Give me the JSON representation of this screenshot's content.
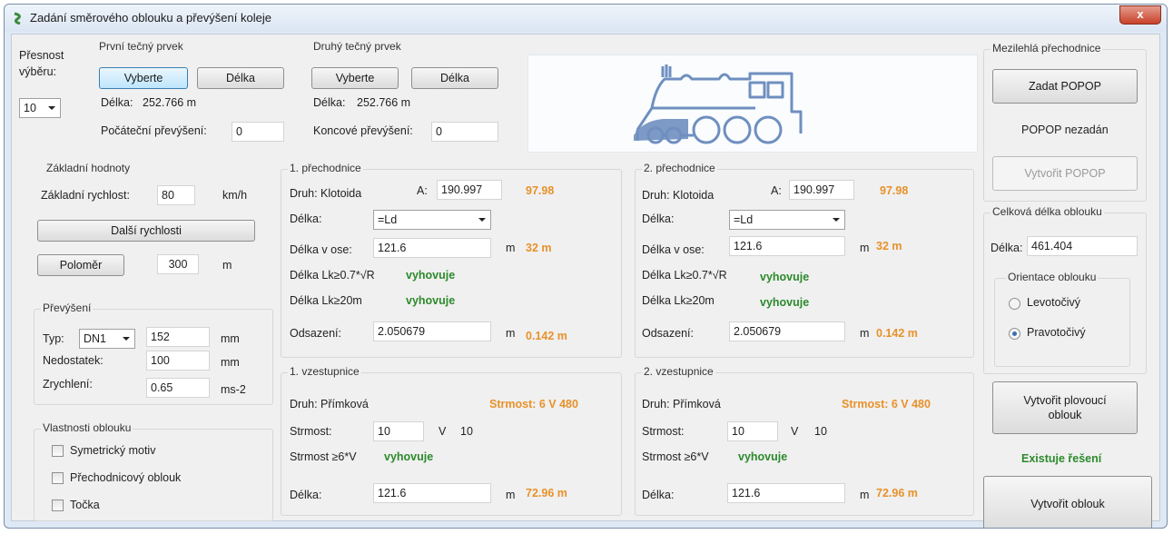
{
  "window": {
    "title": "Zadání směrového oblouku a převýšení koleje",
    "close": "x"
  },
  "precision": {
    "label1": "Přesnost",
    "label2": "výběru:",
    "value": "10"
  },
  "first": {
    "title": "První tečný prvek",
    "select_btn": "Vyberte",
    "length_btn": "Délka",
    "length_label": "Délka:",
    "length_value": "252.766 m",
    "cant_label": "Počáteční převýšení:",
    "cant_value": "0"
  },
  "second": {
    "title": "Druhý tečný prvek",
    "select_btn": "Vyberte",
    "length_btn": "Délka",
    "length_label": "Délka:",
    "length_value": "252.766 m",
    "cant_label": "Koncové převýšení:",
    "cant_value": "0"
  },
  "basic": {
    "title": "Základní hodnoty",
    "speed_label": "Základní rychlost:",
    "speed_value": "80",
    "speed_unit": "km/h",
    "more_speeds": "Další rychlosti",
    "radius_btn": "Poloměr",
    "radius_value": "300",
    "radius_unit": "m"
  },
  "cant": {
    "title": "Převýšení",
    "type_label": "Typ:",
    "type_value": "DN1",
    "type_num": "152",
    "type_unit": "mm",
    "deficit_label": "Nedostatek:",
    "deficit_value": "100",
    "deficit_unit": "mm",
    "accel_label": "Zrychlení:",
    "accel_value": "0.65",
    "accel_unit": "ms-2"
  },
  "props": {
    "title": "Vlastnosti oblouku",
    "items": [
      "Symetrický motiv",
      "Přechodnicový oblouk",
      "Točka"
    ]
  },
  "trans1": {
    "title": "1. přechodnice",
    "kind": "Druh: Klotoida",
    "a_label": "A:",
    "a_value": "190.997",
    "a_result": "97.98",
    "len_label": "Délka:",
    "len_select": "=Ld",
    "axis_label": "Délka v ose:",
    "axis_value": "121.6",
    "axis_unit": "m",
    "axis_result": "32 m",
    "check1_label": "Délka Lk≥0.7*√R",
    "check1_result": "vyhovuje",
    "check2_label": "Délka Lk≥20m",
    "check2_result": "vyhovuje",
    "offset_label": "Odsazení:",
    "offset_value": "2.050679",
    "offset_unit": "m",
    "offset_result": "0.142 m"
  },
  "trans2": {
    "title": "2. přechodnice",
    "kind": "Druh: Klotoida",
    "a_label": "A:",
    "a_value": "190.997",
    "a_result": "97.98",
    "len_label": "Délka:",
    "len_select": "=Ld",
    "axis_label": "Délka v ose:",
    "axis_value": "121.6",
    "axis_unit": "m",
    "axis_result": "32 m",
    "check1_label": "Délka Lk≥0.7*√R",
    "check1_result": "vyhovuje",
    "check2_label": "Délka Lk≥20m",
    "check2_result": "vyhovuje",
    "offset_label": "Odsazení:",
    "offset_value": "2.050679",
    "offset_unit": "m",
    "offset_result": "0.142 m"
  },
  "ramp1": {
    "title": "1. vzestupnice",
    "kind": "Druh: Přímková",
    "steep_result": "Strmost: 6 V 480",
    "steep_label": "Strmost:",
    "steep_value": "10",
    "steep_v": "V",
    "steep_v_value": "10",
    "check_label": "Strmost ≥6*V",
    "check_result": "vyhovuje",
    "len_label": "Délka:",
    "len_value": "121.6",
    "len_unit": "m",
    "len_result": "72.96 m"
  },
  "ramp2": {
    "title": "2. vzestupnice",
    "kind": "Druh: Přímková",
    "steep_result": "Strmost: 6 V 480",
    "steep_label": "Strmost:",
    "steep_value": "10",
    "steep_v": "V",
    "steep_v_value": "10",
    "check_label": "Strmost ≥6*V",
    "check_result": "vyhovuje",
    "len_label": "Délka:",
    "len_value": "121.6",
    "len_unit": "m",
    "len_result": "72.96 m"
  },
  "intermediate": {
    "title": "Mezilehlá přechodnice",
    "enter_btn": "Zadat POPOP",
    "status": "POPOP nezadán",
    "create_btn": "Vytvořit POPOP"
  },
  "total": {
    "title": "Celková délka oblouku",
    "len_label": "Délka:",
    "len_value": "461.404"
  },
  "orientation": {
    "title": "Orientace oblouku",
    "left": "Levotočivý",
    "right": "Pravotočivý"
  },
  "actions": {
    "floating_btn_l1": "Vytvořit plovoucí",
    "floating_btn_l2": "oblouk",
    "solution": "Existuje řešení",
    "create_btn": "Vytvořit oblouk"
  }
}
